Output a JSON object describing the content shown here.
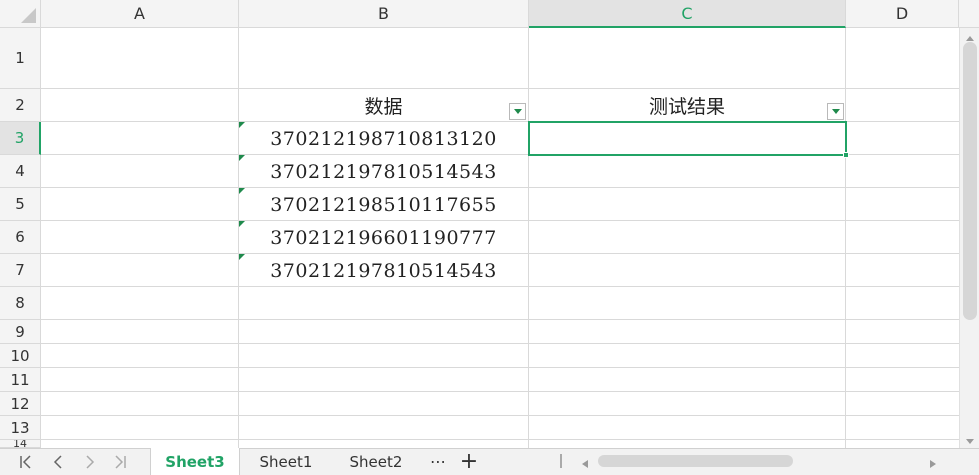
{
  "columns": [
    "A",
    "B",
    "C",
    "D"
  ],
  "rows": [
    "1",
    "2",
    "3",
    "4",
    "5",
    "6",
    "7",
    "8",
    "9",
    "10",
    "11",
    "12",
    "13",
    "14"
  ],
  "header_row": {
    "data": "数据",
    "result": "测试结果"
  },
  "data_values": [
    "370212198710813120",
    "370212197810514543",
    "370212198510117655",
    "370212196601190777",
    "370212197810514543"
  ],
  "sheets": [
    "Sheet3",
    "Sheet1",
    "Sheet2"
  ],
  "active_sheet": "Sheet3",
  "selected_cell": "C3",
  "accent_color": "#21a366",
  "more_label": "⋯",
  "add_label": "+"
}
